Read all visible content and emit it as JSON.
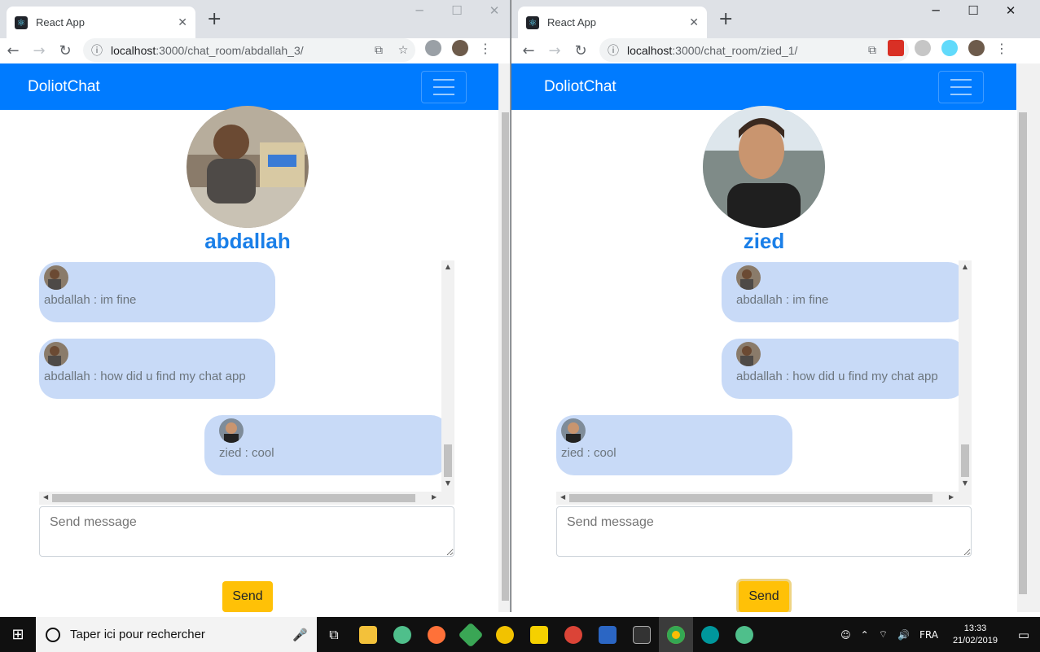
{
  "left_window": {
    "tab_title": "React App",
    "url_host": "localhost",
    "url_path": ":3000/chat_room/abdallah_3/",
    "brand": "DoliotChat",
    "username": "abdallah",
    "messages": [
      {
        "text": "abdallah : im fine",
        "side": "left"
      },
      {
        "text": "abdallah : how did u find my chat app",
        "side": "left"
      },
      {
        "text": "zied : cool",
        "side": "right"
      }
    ],
    "input_placeholder": "Send message",
    "send_label": "Send"
  },
  "right_window": {
    "tab_title": "React App",
    "url_host": "localhost",
    "url_path": ":3000/chat_room/zied_1/",
    "brand": "DoliotChat",
    "username": "zied",
    "messages": [
      {
        "text": "abdallah : im fine",
        "side": "right"
      },
      {
        "text": "abdallah : how did u find my chat app",
        "side": "right"
      },
      {
        "text": "zied : cool",
        "side": "left"
      }
    ],
    "input_placeholder": "Send message",
    "send_label": "Send"
  },
  "taskbar": {
    "search_placeholder": "Taper ici pour rechercher",
    "language": "FRA",
    "time": "13:33",
    "date": "21/02/2019"
  },
  "colors": {
    "navbar": "#007bff",
    "username": "#1a7fe8",
    "bubble": "#c8daf7",
    "send_button": "#ffc107"
  }
}
